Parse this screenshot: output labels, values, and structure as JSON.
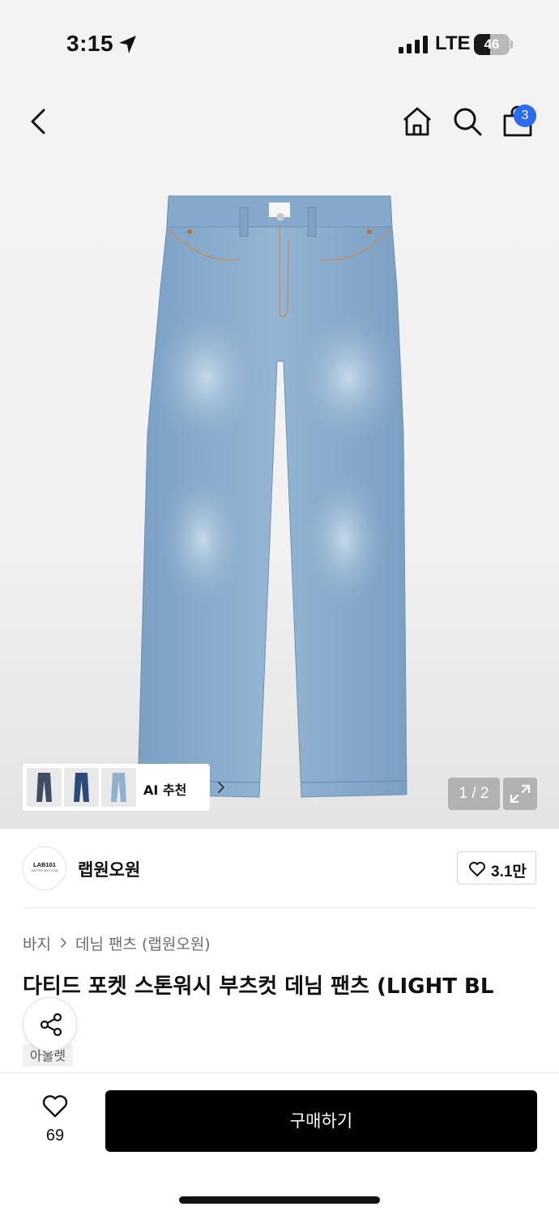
{
  "status_bar": {
    "time": "3:15",
    "network": "LTE",
    "battery_level": "46",
    "battery_percent": 46
  },
  "nav": {
    "cart_count": "3",
    "icons": [
      "back-chevron-icon",
      "home-icon",
      "search-icon",
      "shopping-bag-icon"
    ]
  },
  "gallery": {
    "ai_label": "AI 추천",
    "page_counter": "1 / 2",
    "current_page": 1,
    "total_pages": 2,
    "thumbnail_colors": [
      "#3d4e66",
      "#2d4a78",
      "#8fb0cf"
    ],
    "icons": [
      "expand-icon",
      "chevron-right-icon"
    ]
  },
  "brand": {
    "logo_text": "LAB101",
    "logo_subtext": "MATTER FACT.COM",
    "name": "랩원오원",
    "like_count": "3.1만"
  },
  "breadcrumb": {
    "items": [
      "바지",
      "데님 팬츠 (랩원오원)"
    ]
  },
  "product": {
    "title": "다티드 포켓 스톤워시 부츠컷 데님 팬츠 (LIGHT BL",
    "badge": "아울렛"
  },
  "bottom_bar": {
    "wish_count": "69",
    "buy_label": "구매하기"
  },
  "colors": {
    "accent_badge": "#2c6bf2",
    "buy_button": "#000000"
  }
}
